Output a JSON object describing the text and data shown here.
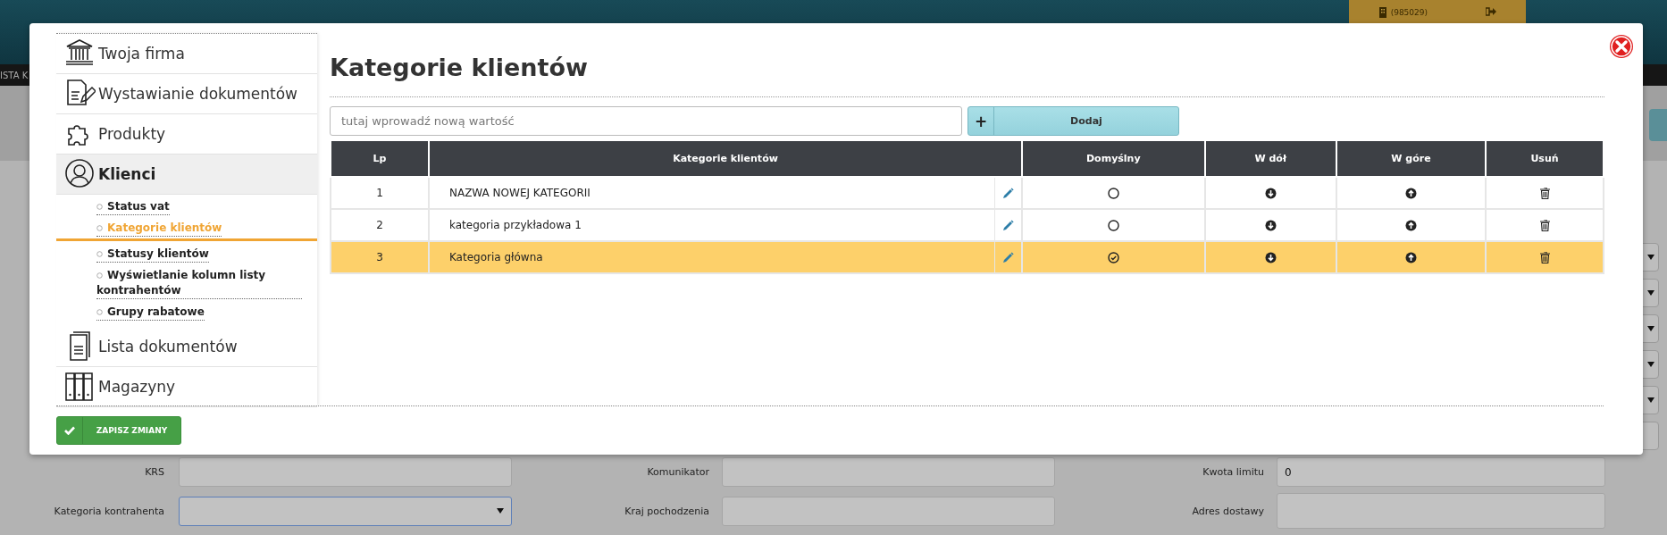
{
  "background": {
    "account_badge": "(985029)",
    "menu_text": "ISTA K",
    "form_rows": [
      [
        {
          "label": "KRS",
          "kind": "text",
          "focused": false
        },
        {
          "label": "Komunikator",
          "kind": "text",
          "focused": false
        },
        {
          "label": "Kwota limitu",
          "kind": "text",
          "value": "0",
          "focused": false
        }
      ],
      [
        {
          "label": "Kategoria kontrahenta",
          "kind": "select",
          "focused": true
        },
        {
          "label": "Kraj pochodzenia",
          "kind": "text",
          "focused": false
        },
        {
          "label": "Adres dostawy",
          "kind": "textarea",
          "focused": false
        }
      ]
    ]
  },
  "sidebar": {
    "items": [
      {
        "label": "Twoja firma",
        "selected": false
      },
      {
        "label": "Wystawianie dokumentów",
        "selected": false
      },
      {
        "label": "Produkty",
        "selected": false
      },
      {
        "label": "Klienci",
        "selected": true,
        "children": [
          {
            "label": "Status vat",
            "selected": false
          },
          {
            "label": "Kategorie klientów",
            "selected": true
          },
          {
            "label": "Statusy klientów",
            "selected": false
          },
          {
            "label": "Wyświetlanie kolumn listy kontrahentów",
            "selected": false
          },
          {
            "label": "Grupy rabatowe",
            "selected": false
          }
        ]
      },
      {
        "label": "Lista dokumentów",
        "selected": false
      },
      {
        "label": "Magazyny",
        "selected": false
      }
    ]
  },
  "panel": {
    "title": "Kategorie klientów",
    "new_value": {
      "placeholder": "tutaj wprowadź nową wartość"
    },
    "add_button": {
      "icon": "+",
      "label": "Dodaj"
    },
    "table": {
      "columns": [
        "Lp",
        "Kategorie klientów",
        "Domyślny",
        "W dół",
        "W góre",
        "Usuń"
      ],
      "rows": [
        {
          "lp": "1",
          "name": "NAZWA NOWEJ KATEGORII",
          "default": false,
          "selected": false
        },
        {
          "lp": "2",
          "name": "kategoria przykładowa 1",
          "default": false,
          "selected": false
        },
        {
          "lp": "3",
          "name": "Kategoria główna",
          "default": true,
          "selected": true
        }
      ]
    }
  },
  "save_button": {
    "label": "ZAPISZ ZMIANY"
  }
}
